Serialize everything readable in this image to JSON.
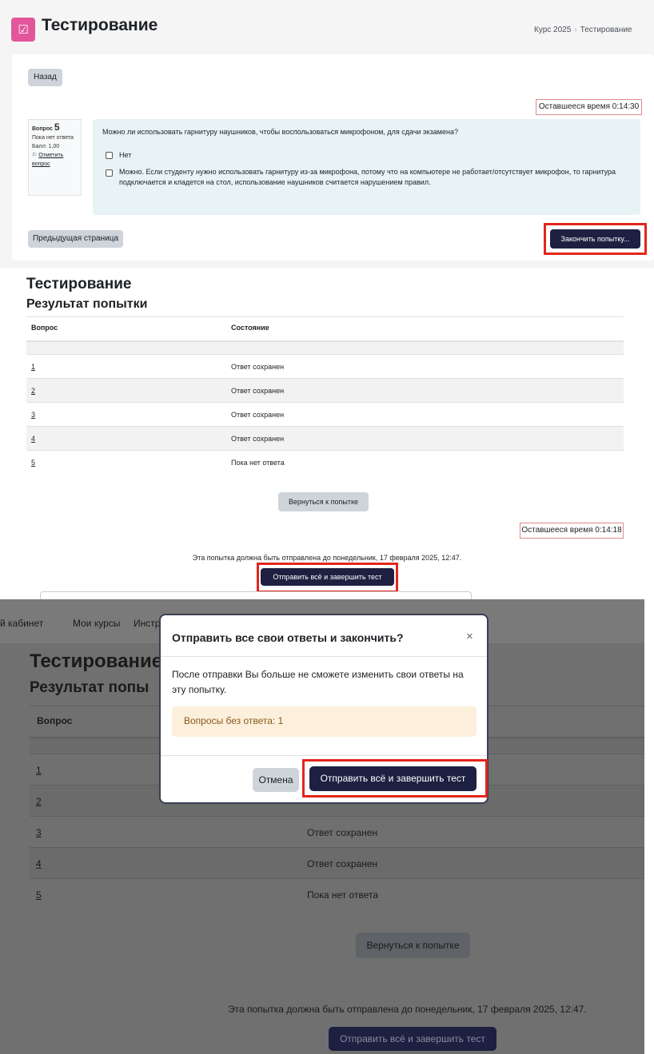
{
  "panel1": {
    "title": "Тестирование",
    "breadcrumb": [
      "Курс 2025",
      "Тестирование"
    ],
    "back_label": "Назад",
    "timer": "Оставшееся время 0:14:30",
    "question": {
      "label": "Вопрос",
      "number": "5",
      "status": "Пока нет ответа",
      "score": "Балл: 1,00",
      "flag": "Отметить вопрос",
      "text": "Можно ли использовать гарнитуру наушников, чтобы воспользоваться микрофоном, для сдачи экзамена?",
      "options": [
        "Нет",
        "Можно. Если студенту нужно использовать гарнитуру из-за микрофона, потому что на компьютере не работает/отсутствует микрофон, то гарнитура подключается и кладется на стол, использование наушников считается нарушением правил."
      ]
    },
    "prev_label": "Предыдущая страница",
    "finish_label": "Закончить попытку..."
  },
  "panel2": {
    "title": "Тестирование",
    "subtitle": "Результат попытки",
    "columns": [
      "Вопрос",
      "Состояние"
    ],
    "rows": [
      {
        "q": "1",
        "state": "Ответ сохранен"
      },
      {
        "q": "2",
        "state": "Ответ сохранен"
      },
      {
        "q": "3",
        "state": "Ответ сохранен"
      },
      {
        "q": "4",
        "state": "Ответ сохранен"
      },
      {
        "q": "5",
        "state": "Пока нет ответа"
      }
    ],
    "return_label": "Вернуться к попытке",
    "timer": "Оставшееся время 0:14:18",
    "deadline": "Эта попытка должна быть отправлена до понедельник, 17 февраля 2025, 12:47.",
    "submit_label": "Отправить всё и завершить тест"
  },
  "panel3": {
    "nav": [
      "й кабинет",
      "Мои курсы",
      "Инстр"
    ],
    "title": "Тестирование",
    "subtitle": "Результат попы",
    "column": "Вопрос",
    "rows": [
      {
        "q": "1",
        "state": ""
      },
      {
        "q": "2",
        "state": ""
      },
      {
        "q": "3",
        "state": "Ответ сохранен"
      },
      {
        "q": "4",
        "state": "Ответ сохранен"
      },
      {
        "q": "5",
        "state": "Пока нет ответа"
      }
    ],
    "return_label": "Вернуться к попытке",
    "deadline": "Эта попытка должна быть отправлена до понедельник, 17 февраля 2025, 12:47.",
    "submit_label": "Отправить всё и завершить тест",
    "modal": {
      "title": "Отправить все свои ответы и закончить?",
      "close": "×",
      "body": "После отправки Вы больше не сможете изменить свои ответы на эту попытку.",
      "alert": "Вопросы без ответа: 1",
      "cancel": "Отмена",
      "confirm": "Отправить всё и завершить тест"
    }
  },
  "colors": {
    "accent_pink": "#e3569b",
    "primary_dark": "#1d2041",
    "highlight_red": "#e3261c",
    "question_bg": "#e7f3f5"
  }
}
